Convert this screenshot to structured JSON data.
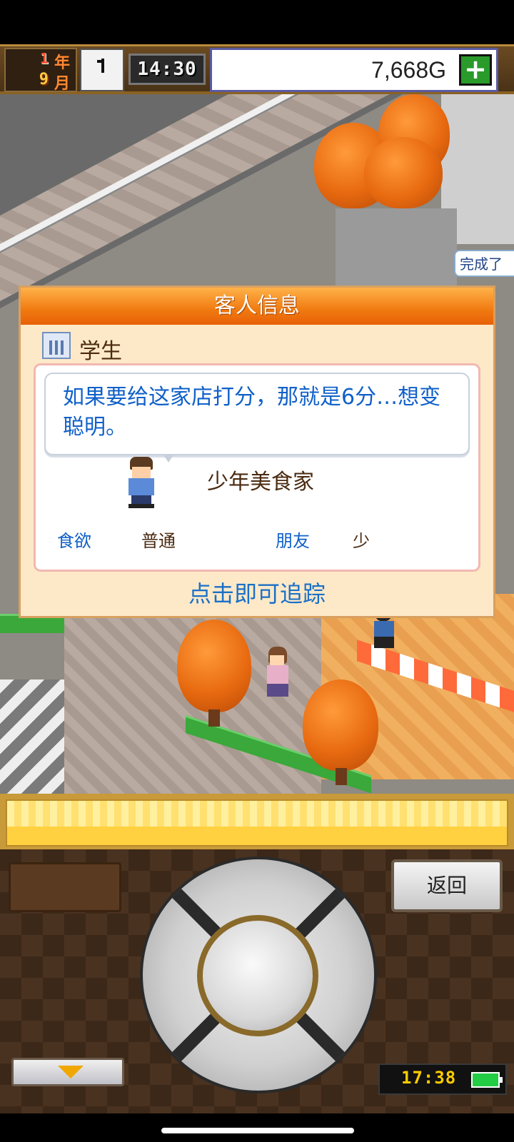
{
  "status": {
    "year_num": "1",
    "year_unit": "年",
    "month_num": "9",
    "month_unit": "月",
    "game_time": "14:30",
    "money": "7,668G",
    "add_money_symbol": "+"
  },
  "scene": {
    "tooltip_text": "完成了"
  },
  "panel": {
    "title": "客人信息",
    "category": "学生",
    "quote": "如果要给这家店打分，那就是6分…想变聪明。",
    "customer_title": "少年美食家",
    "stats": [
      {
        "label": "食欲",
        "value": "普通"
      },
      {
        "label": "朋友",
        "value": "少"
      }
    ],
    "track_label": "点击即可追踪"
  },
  "controls": {
    "back_label": "返回",
    "system_time": "17:38"
  },
  "colors": {
    "header_orange": "#f07a10",
    "quote_blue": "#1060c8",
    "money_plus_green": "#2a9a2a"
  }
}
